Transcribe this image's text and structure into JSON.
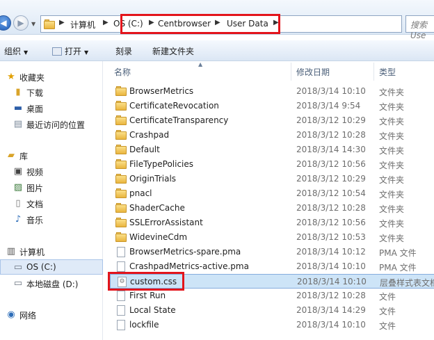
{
  "address": {
    "crumbs": [
      "计算机",
      "OS (C:)",
      "Centbrowser",
      "User Data"
    ],
    "search_placeholder": "搜索 Use"
  },
  "toolbar": {
    "organize": "组织",
    "open": "打开",
    "burn": "刻录",
    "new_folder": "新建文件夹"
  },
  "sidebar": {
    "favorites": "收藏夹",
    "downloads": "下载",
    "desktop": "桌面",
    "recent": "最近访问的位置",
    "libraries": "库",
    "videos": "视频",
    "pictures": "图片",
    "documents": "文档",
    "music": "音乐",
    "computer": "计算机",
    "os_c": "OS (C:)",
    "local_d": "本地磁盘 (D:)",
    "network": "网络"
  },
  "columns": {
    "name": "名称",
    "date": "修改日期",
    "type": "类型"
  },
  "files": [
    {
      "name": "BrowserMetrics",
      "date": "2018/3/14 10:10",
      "type": "文件夹",
      "kind": "folder"
    },
    {
      "name": "CertificateRevocation",
      "date": "2018/3/14 9:54",
      "type": "文件夹",
      "kind": "folder"
    },
    {
      "name": "CertificateTransparency",
      "date": "2018/3/12 10:29",
      "type": "文件夹",
      "kind": "folder"
    },
    {
      "name": "Crashpad",
      "date": "2018/3/12 10:28",
      "type": "文件夹",
      "kind": "folder"
    },
    {
      "name": "Default",
      "date": "2018/3/14 14:30",
      "type": "文件夹",
      "kind": "folder"
    },
    {
      "name": "FileTypePolicies",
      "date": "2018/3/12 10:56",
      "type": "文件夹",
      "kind": "folder"
    },
    {
      "name": "OriginTrials",
      "date": "2018/3/12 10:29",
      "type": "文件夹",
      "kind": "folder"
    },
    {
      "name": "pnacl",
      "date": "2018/3/12 10:54",
      "type": "文件夹",
      "kind": "folder"
    },
    {
      "name": "ShaderCache",
      "date": "2018/3/12 10:28",
      "type": "文件夹",
      "kind": "folder"
    },
    {
      "name": "SSLErrorAssistant",
      "date": "2018/3/12 10:56",
      "type": "文件夹",
      "kind": "folder"
    },
    {
      "name": "WidevineCdm",
      "date": "2018/3/12 10:53",
      "type": "文件夹",
      "kind": "folder"
    },
    {
      "name": "BrowserMetrics-spare.pma",
      "date": "2018/3/14 10:12",
      "type": "PMA 文件",
      "kind": "file"
    },
    {
      "name": "CrashpadMetrics-active.pma",
      "date": "2018/3/14 10:10",
      "type": "PMA 文件",
      "kind": "file"
    },
    {
      "name": "custom.css",
      "date": "2018/3/14 10:10",
      "type": "层叠样式表文档",
      "kind": "css"
    },
    {
      "name": "First Run",
      "date": "2018/3/12 10:28",
      "type": "文件",
      "kind": "file"
    },
    {
      "name": "Local State",
      "date": "2018/3/14 14:29",
      "type": "文件",
      "kind": "file"
    },
    {
      "name": "lockfile",
      "date": "2018/3/14 10:10",
      "type": "文件",
      "kind": "file"
    }
  ]
}
